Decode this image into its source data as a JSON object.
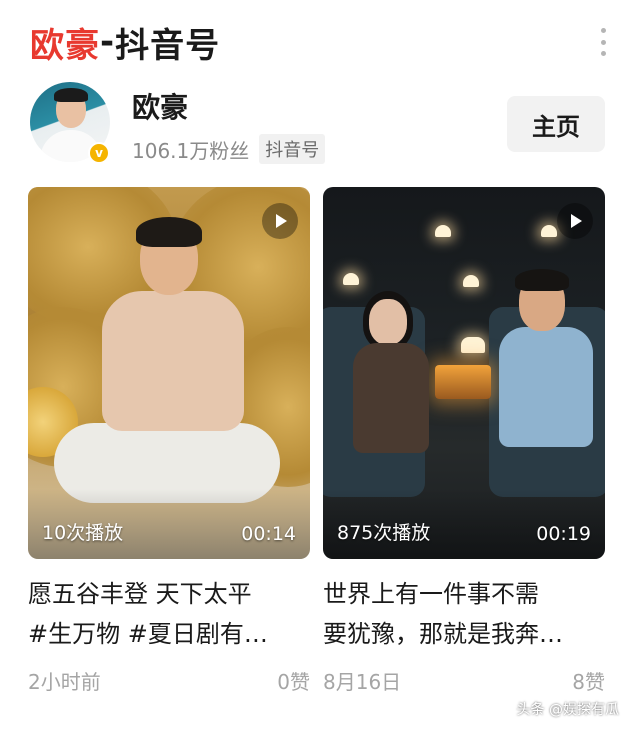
{
  "header": {
    "account_name": "欧豪",
    "separator": "-",
    "suffix": "抖音号"
  },
  "account": {
    "name": "欧豪",
    "followers": "106.1万粉丝",
    "platform_tag": "抖音号",
    "home_button": "主页",
    "verified_mark": "v"
  },
  "videos": [
    {
      "play_count": "10次播放",
      "duration": "00:14",
      "caption_line1": "愿五谷丰登 天下太平",
      "caption_line2": "#生万物 #夏日剧有…",
      "time": "2小时前",
      "likes": "0赞"
    },
    {
      "play_count": "875次播放",
      "duration": "00:19",
      "caption_line1": "世界上有一件事不需",
      "caption_line2": "要犹豫，那就是我奔…",
      "time": "8月16日",
      "likes": "8赞"
    }
  ],
  "watermark": "头条 @娱探有瓜",
  "colors": {
    "title_accent": "#e8392f",
    "verified": "#f5b400",
    "secondary_text": "#8a8a8a"
  }
}
